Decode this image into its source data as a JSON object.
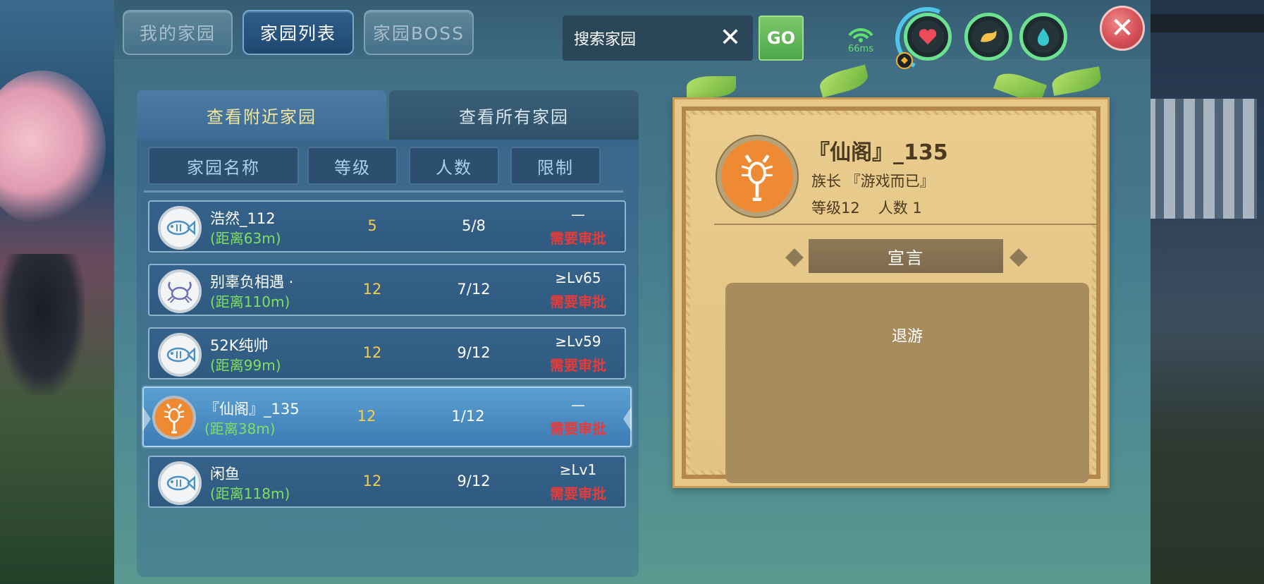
{
  "tabs": [
    {
      "label": "我的家园",
      "active": false
    },
    {
      "label": "家园列表",
      "active": true
    },
    {
      "label": "家园BOSS",
      "active": false
    }
  ],
  "search": {
    "placeholder": "搜索家园",
    "go_label": "GO"
  },
  "ping": {
    "label": "66ms"
  },
  "status_icons": [
    "heart-icon",
    "stamina-icon",
    "water-drop-icon"
  ],
  "sub_tabs": [
    {
      "label": "查看附近家园",
      "active": true
    },
    {
      "label": "查看所有家园",
      "active": false
    }
  ],
  "columns": [
    "家园名称",
    "等级",
    "人数",
    "限制"
  ],
  "rows": [
    {
      "icon": "fish-icon",
      "name": "浩然_112",
      "distance": "(距离63m)",
      "level": "5",
      "members": "5/8",
      "limit": "—",
      "approval": "需要审批",
      "selected": false
    },
    {
      "icon": "crab-icon",
      "name": "别辜负相遇 ·",
      "distance": "(距离110m)",
      "level": "12",
      "members": "7/12",
      "limit": "≥Lv65",
      "approval": "需要审批",
      "selected": false
    },
    {
      "icon": "fish-icon",
      "name": "52K纯帅",
      "distance": "(距离99m)",
      "level": "12",
      "members": "9/12",
      "limit": "≥Lv59",
      "approval": "需要审批",
      "selected": false
    },
    {
      "icon": "scorpion-icon",
      "name": "『仙阁』_135",
      "distance": "(距离38m)",
      "level": "12",
      "members": "1/12",
      "limit": "—",
      "approval": "需要审批",
      "selected": true
    },
    {
      "icon": "fish-icon",
      "name": "闲鱼",
      "distance": "(距离118m)",
      "level": "12",
      "members": "9/12",
      "limit": "≥Lv1",
      "approval": "需要审批",
      "selected": false
    }
  ],
  "detail": {
    "icon": "scorpion-icon",
    "title": "『仙阁』_135",
    "leader": "族长 『游戏而已』",
    "level": "等级12",
    "members": "人数 1",
    "banner": "宣言",
    "manifesto": "退游"
  },
  "colors": {
    "accent_yellow": "#f3e59c",
    "distance_green": "#7ee05e",
    "approve_red": "#e53b3b",
    "level_yellow": "#f6cd4a",
    "emblem_orange": "#ed8a33"
  }
}
